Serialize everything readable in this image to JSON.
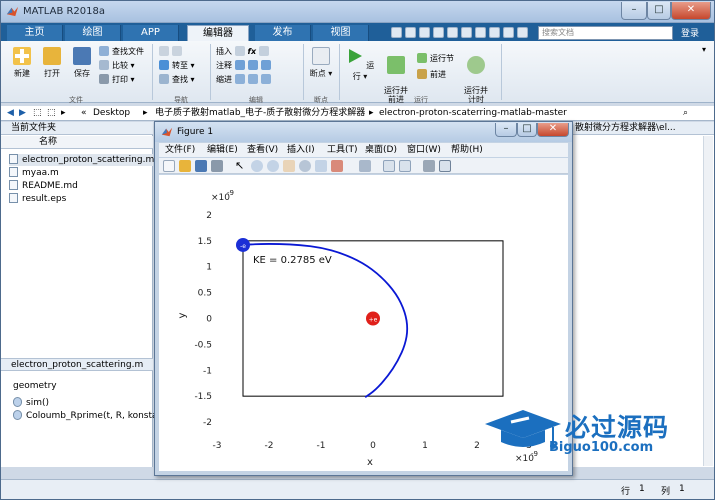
{
  "window": {
    "title": "MATLAB R2018a",
    "minimize": "–",
    "restore": "□",
    "close": "✕"
  },
  "tabs": [
    "主页",
    "绘图",
    "APP",
    "编辑器",
    "发布",
    "视图"
  ],
  "search": {
    "placeholder": "搜索文档"
  },
  "login": "登录",
  "ribbon": {
    "new": "新建",
    "open": "打开",
    "save": "保存",
    "find_files": "查找文件",
    "compare": "比较",
    "print": "打印",
    "goto": "转至",
    "find": "查找",
    "insert": "插入",
    "comment": "注释",
    "indent": "缩进",
    "breakpoint": "断点",
    "run": "运行",
    "run_advance": "运行并\n前进",
    "run_section": "运行节",
    "advance": "前进",
    "run_time": "运行并\n计时",
    "groups": [
      "文件",
      "导航",
      "编辑",
      "断点",
      "运行"
    ]
  },
  "address": {
    "segments": [
      "«",
      "Desktop",
      "▸",
      "电子质子散射matlab_电子-质子散射微分方程求解器",
      "▸",
      "electron-proton-scaterring-matlab-master"
    ],
    "right_path": "散射微分方程求解器\\el..."
  },
  "current_folder": {
    "title": "当前文件夹",
    "col_name": "名称",
    "files": [
      "electron_proton_scattering.m",
      "myaa.m",
      "README.md",
      "result.eps"
    ]
  },
  "details": {
    "title": "electron_proton_scattering.m",
    "section": "geometry",
    "items": [
      "sim()",
      "Coloumb_Rprime(t, R, konsta..."
    ]
  },
  "status": {
    "row_label": "行",
    "row_value": "1",
    "col_label": "列",
    "col_value": "1"
  },
  "figure": {
    "title": "Figure 1",
    "menu": [
      "文件(F)",
      "编辑(E)",
      "查看(V)",
      "插入(I)",
      "工具(T)",
      "桌面(D)",
      "窗口(W)",
      "帮助(H)"
    ]
  },
  "chart_data": {
    "type": "line",
    "x_multiplier": "×10",
    "x_multiplier_exp": "-9",
    "y_multiplier": "×10",
    "y_multiplier_exp": "-9",
    "xlabel": "x",
    "ylabel": "y",
    "xlim": [
      -3,
      3
    ],
    "ylim": [
      -2.25,
      2.25
    ],
    "xticks": [
      -3,
      -2,
      -1,
      0,
      1,
      2,
      3
    ],
    "yticks": [
      -2,
      -1.5,
      -1,
      -0.5,
      0,
      0.5,
      1,
      1.5,
      2
    ],
    "box": {
      "x": [
        -2.5,
        2.5
      ],
      "y": [
        -1.5,
        1.5
      ]
    },
    "annotation": "KE = 0.2785 eV",
    "trajectory": {
      "color": "#0a18d4",
      "x": [
        -2.5,
        -2.2,
        -1.8,
        -1.4,
        -1.0,
        -0.6,
        -0.2,
        0.15,
        0.45,
        0.62,
        0.67,
        0.62,
        0.48,
        0.28,
        0.05,
        -0.15
      ],
      "y": [
        1.42,
        1.44,
        1.44,
        1.42,
        1.37,
        1.26,
        1.08,
        0.82,
        0.48,
        0.12,
        -0.2,
        -0.5,
        -0.82,
        -1.12,
        -1.38,
        -1.52
      ]
    },
    "electron": {
      "x": -2.5,
      "y": 1.42,
      "label": "-e",
      "color": "#1b2fd6"
    },
    "proton": {
      "x": 0,
      "y": 0,
      "label": "+e",
      "color": "#e0201a"
    }
  },
  "watermark": {
    "text": "必过源码",
    "url": "Biguo100.com"
  }
}
